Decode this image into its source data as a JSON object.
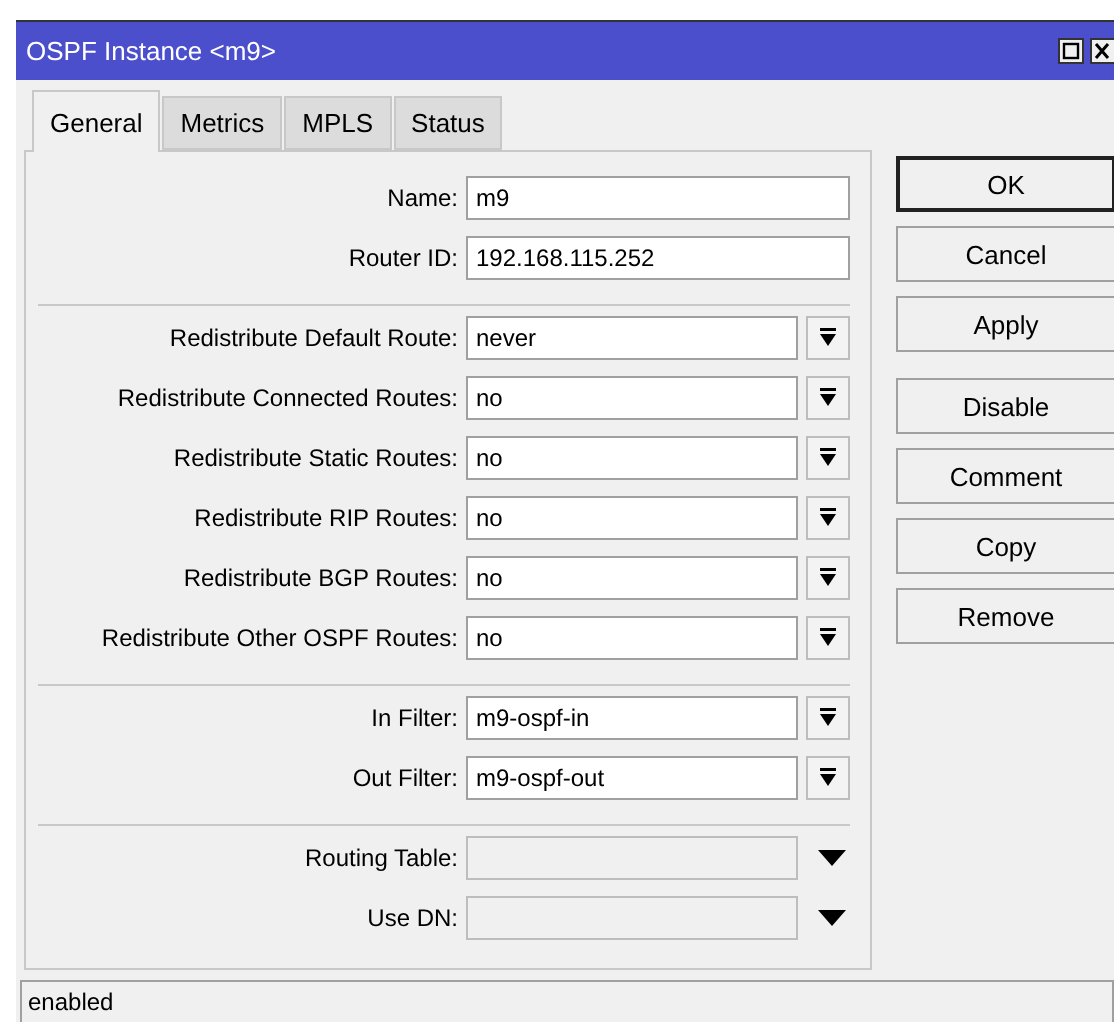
{
  "window": {
    "title": "OSPF Instance <m9>"
  },
  "tabs": [
    {
      "label": "General",
      "selected": true
    },
    {
      "label": "Metrics",
      "selected": false
    },
    {
      "label": "MPLS",
      "selected": false
    },
    {
      "label": "Status",
      "selected": false
    }
  ],
  "sections": [
    {
      "rows": [
        {
          "label": "Name:",
          "kind": "text",
          "value": "m9"
        },
        {
          "label": "Router ID:",
          "kind": "text",
          "value": "192.168.115.252"
        }
      ]
    },
    {
      "rows": [
        {
          "label": "Redistribute Default Route:",
          "kind": "dropdown",
          "value": "never"
        },
        {
          "label": "Redistribute Connected Routes:",
          "kind": "dropdown",
          "value": "no"
        },
        {
          "label": "Redistribute Static Routes:",
          "kind": "dropdown",
          "value": "no"
        },
        {
          "label": "Redistribute RIP Routes:",
          "kind": "dropdown",
          "value": "no"
        },
        {
          "label": "Redistribute BGP Routes:",
          "kind": "dropdown",
          "value": "no"
        },
        {
          "label": "Redistribute Other OSPF Routes:",
          "kind": "dropdown",
          "value": "no"
        }
      ]
    },
    {
      "rows": [
        {
          "label": "In Filter:",
          "kind": "dropdown",
          "value": "m9-ospf-in"
        },
        {
          "label": "Out Filter:",
          "kind": "dropdown",
          "value": "m9-ospf-out"
        }
      ]
    },
    {
      "rows": [
        {
          "label": "Routing Table:",
          "kind": "optional"
        },
        {
          "label": "Use DN:",
          "kind": "optional"
        }
      ]
    }
  ],
  "button_groups": [
    {
      "buttons": [
        {
          "label": "OK",
          "default": true
        },
        {
          "label": "Cancel",
          "default": false
        },
        {
          "label": "Apply",
          "default": false
        }
      ]
    },
    {
      "buttons": [
        {
          "label": "Disable",
          "default": false
        },
        {
          "label": "Comment",
          "default": false
        },
        {
          "label": "Copy",
          "default": false
        },
        {
          "label": "Remove",
          "default": false
        }
      ]
    }
  ],
  "status_bar": {
    "text": "enabled"
  }
}
